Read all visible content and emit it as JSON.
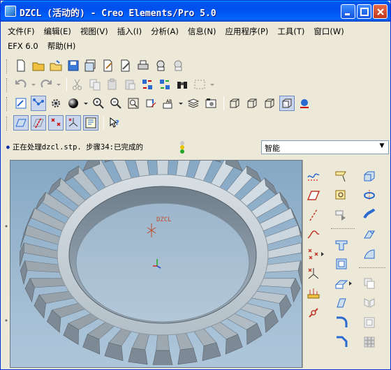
{
  "window": {
    "title": "DZCL (活动的) - Creo Elements/Pro 5.0"
  },
  "menubar": {
    "row1": [
      "文件(F)",
      "编辑(E)",
      "视图(V)",
      "插入(I)",
      "分析(A)",
      "信息(N)",
      "应用程序(P)",
      "工具(T)",
      "窗口(W)"
    ],
    "row2": [
      "EFX 6.0",
      "帮助(H)"
    ]
  },
  "status": {
    "message": "正在处理dzcl.stp. 步骤34:已完成的",
    "filter_value": "智能"
  },
  "viewport": {
    "csys_label": "DZCL"
  },
  "colors": {
    "titlebar": "#0054e3",
    "viewport_bg": "#9cb8cf",
    "gear": "#b8c3cc"
  }
}
